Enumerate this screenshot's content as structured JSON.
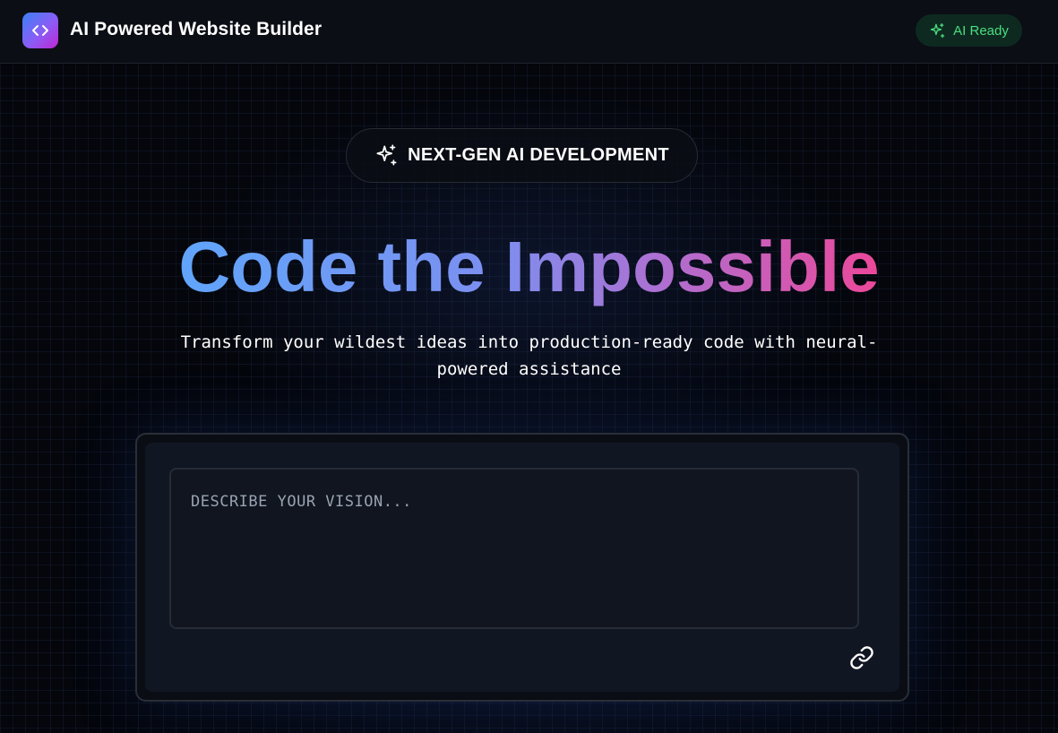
{
  "header": {
    "title": "AI Powered Website Builder",
    "logo_icon": "code-brackets-icon",
    "status": {
      "label": "AI Ready",
      "icon": "sparkles-icon",
      "color": "#4ade80"
    }
  },
  "hero": {
    "badge": {
      "label": "NEXT-GEN AI DEVELOPMENT",
      "icon": "sparkles-icon"
    },
    "headline": "Code the Impossible",
    "subtitle": "Transform your wildest ideas into production-ready code with neural-powered assistance"
  },
  "prompt": {
    "placeholder": "DESCRIBE YOUR VISION...",
    "value": "",
    "attach_icon": "link-icon"
  },
  "colors": {
    "background": "#04060c",
    "accent_blue": "#60a5fa",
    "accent_pink": "#ec4899",
    "status_green": "#4ade80"
  }
}
